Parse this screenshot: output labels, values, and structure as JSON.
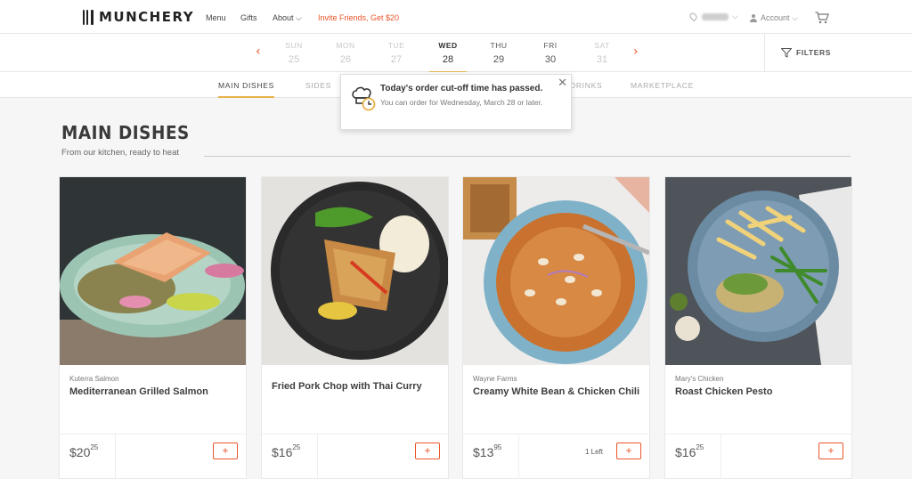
{
  "nav": {
    "brand": "MUNCHERY",
    "menu": "Menu",
    "gifts": "Gifts",
    "about": "About ⌵",
    "invite": "Invite Friends, Get $20",
    "account": "Account ⌵"
  },
  "dates": [
    {
      "dow": "SUN",
      "num": "25"
    },
    {
      "dow": "MON",
      "num": "26"
    },
    {
      "dow": "TUE",
      "num": "27"
    },
    {
      "dow": "WED",
      "num": "28"
    },
    {
      "dow": "THU",
      "num": "29"
    },
    {
      "dow": "FRI",
      "num": "30"
    },
    {
      "dow": "SAT",
      "num": "31"
    }
  ],
  "filters_label": "FILTERS",
  "categories": [
    "MAIN DISHES",
    "SIDES",
    "DRINKS",
    "MARKETPLACE"
  ],
  "notice": {
    "title": "Today's order cut-off time has passed.",
    "body": "You can order for Wednesday, March 28 or later.",
    "close": "✕"
  },
  "section": {
    "title": "MAIN DISHES",
    "subtitle": "From our kitchen, ready to heat"
  },
  "dishes": [
    {
      "vendor": "Kuterra Salmon",
      "name": "Mediterranean Grilled Salmon",
      "price_whole": "$20",
      "price_cents": "25",
      "left": "",
      "add": "+"
    },
    {
      "vendor": "",
      "name": "Fried Pork Chop with Thai Curry",
      "price_whole": "$16",
      "price_cents": "25",
      "left": "",
      "add": "+"
    },
    {
      "vendor": "Wayne Farms",
      "name": "Creamy White Bean & Chicken Chili",
      "price_whole": "$13",
      "price_cents": "95",
      "left": "1 Left",
      "add": "+"
    },
    {
      "vendor": "Mary's Chicken",
      "name": "Roast Chicken Pesto",
      "price_whole": "$16",
      "price_cents": "25",
      "left": "",
      "add": "+"
    }
  ],
  "colors": {
    "accent": "#e9562b",
    "underline": "#e8b24a"
  }
}
